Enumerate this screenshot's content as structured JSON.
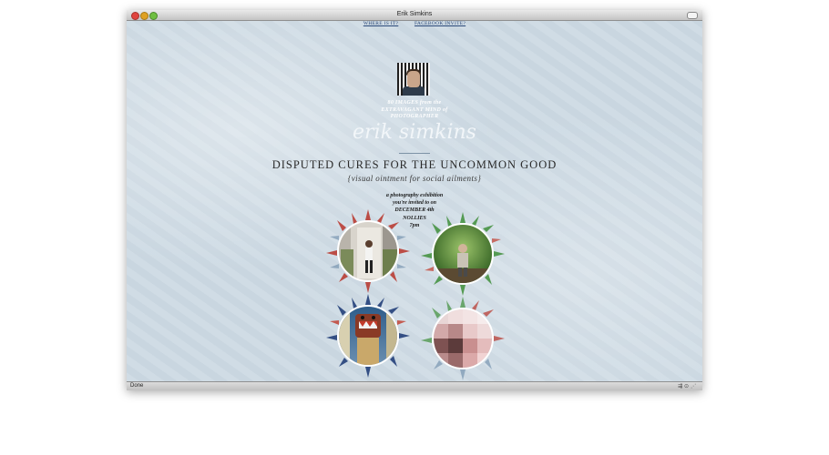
{
  "window": {
    "title": "Erik Simkins"
  },
  "nav": {
    "where_label": "WHERE IS IT?",
    "facebook_label": "FACEBOOK INVITE?"
  },
  "hero": {
    "tagline_1": "80 IMAGES from the",
    "tagline_2": "EXTRAVAGANT MIND of",
    "tagline_3": "PHOTOGRAPHER",
    "name": "erik simkins",
    "headline": "DISPUTED CURES FOR THE UNCOMMON GOOD",
    "subhead": "{visual ointment for social ailments}"
  },
  "details": {
    "line_1": "a photography exhibition",
    "line_2": "you're invited to on",
    "line_3": "DECEMBER 4th",
    "line_4": "NOLLIES",
    "line_5": "7pm"
  },
  "status": {
    "text": "Done"
  },
  "colors": {
    "background": "#cddae4",
    "accent_red": "#c0392b",
    "accent_green": "#3f8f3a",
    "accent_blue": "#23407a"
  }
}
